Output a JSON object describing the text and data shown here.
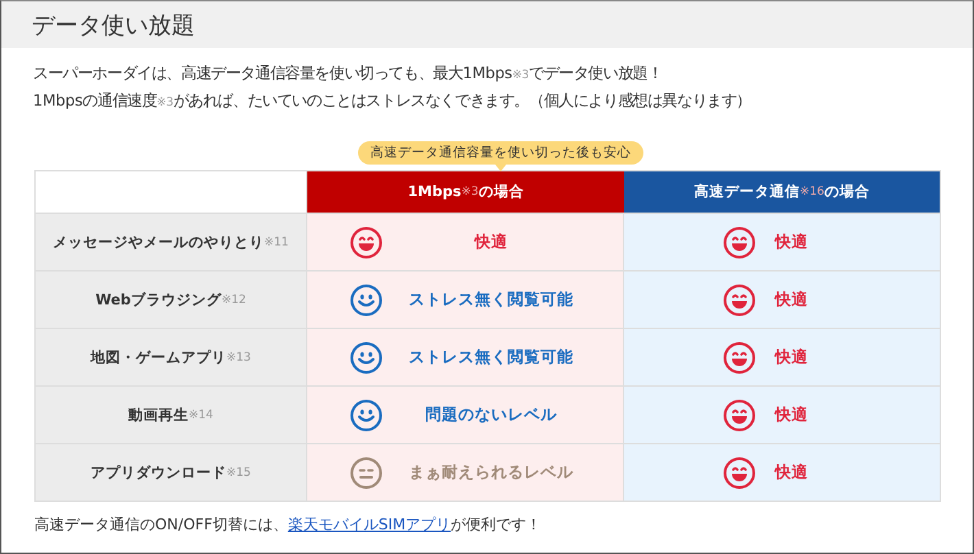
{
  "title": "データ使い放題",
  "intro": [
    [
      {
        "kind": "text",
        "text": "スーパーホーダイは、高速データ通信容量を使い切っても、最大1Mbps"
      },
      {
        "kind": "note",
        "text": "※3"
      },
      {
        "kind": "text",
        "text": "でデータ使い放題！"
      }
    ],
    [
      {
        "kind": "text",
        "text": "1Mbpsの通信速度"
      },
      {
        "kind": "note",
        "text": "※3"
      },
      {
        "kind": "text",
        "text": "があれば、たいていのことはストレスなくできます。（個人により感想は異なります）"
      }
    ]
  ],
  "callout": "高速データ通信容量を使い切った後も安心",
  "table": {
    "columns": [
      {
        "kind": "red",
        "parts": [
          {
            "kind": "text",
            "text": "1Mbps"
          },
          {
            "kind": "note",
            "text": "※3"
          },
          {
            "kind": "text",
            "text": "の場合"
          }
        ]
      },
      {
        "kind": "blue",
        "parts": [
          {
            "kind": "text",
            "text": "高速データ通信"
          },
          {
            "kind": "note",
            "text": "※16"
          },
          {
            "kind": "text",
            "text": "の場合"
          }
        ]
      }
    ],
    "rows": [
      {
        "label": "メッセージやメールのやりとり",
        "note": "※11",
        "cells": [
          {
            "kind": "great",
            "text": "快適"
          },
          {
            "kind": "great",
            "text": "快適"
          }
        ]
      },
      {
        "label": "Webブラウジング",
        "note": "※12",
        "cells": [
          {
            "kind": "good",
            "text": "ストレス無く閲覧可能"
          },
          {
            "kind": "great",
            "text": "快適"
          }
        ]
      },
      {
        "label": "地図・ゲームアプリ",
        "note": "※13",
        "cells": [
          {
            "kind": "good",
            "text": "ストレス無く閲覧可能"
          },
          {
            "kind": "great",
            "text": "快適"
          }
        ]
      },
      {
        "label": "動画再生",
        "note": "※14",
        "cells": [
          {
            "kind": "good",
            "text": "問題のないレベル"
          },
          {
            "kind": "great",
            "text": "快適"
          }
        ]
      },
      {
        "label": "アプリダウンロード",
        "note": "※15",
        "cells": [
          {
            "kind": "ok",
            "text": "まぁ耐えられるレベル"
          },
          {
            "kind": "great",
            "text": "快適"
          }
        ]
      }
    ]
  },
  "footer": {
    "before": "高速データ通信のON/OFF切替には、",
    "link": "楽天モバイルSIMアプリ",
    "after": "が便利です！"
  }
}
